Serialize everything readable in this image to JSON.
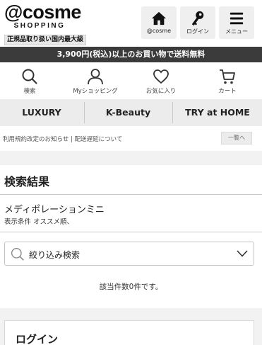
{
  "header": {
    "logo": {
      "main": "@cosme",
      "sub": "SHOPPING",
      "badge": "正規品取り扱い国内最大級"
    },
    "buttons": [
      {
        "label": "@cosme",
        "icon": "home-icon"
      },
      {
        "label": "ログイン",
        "icon": "key-icon"
      },
      {
        "label": "メニュー",
        "icon": "hamburger-icon"
      }
    ]
  },
  "banner": {
    "text": "3,900円(税込)以上のお買い物で送料無料"
  },
  "nav": [
    {
      "label": "検索",
      "icon": "search-icon"
    },
    {
      "label": "Myショッピング",
      "icon": "person-icon"
    },
    {
      "label": "お気に入り",
      "icon": "heart-icon"
    },
    {
      "label": "カート",
      "icon": "cart-icon"
    }
  ],
  "tabs": [
    "LUXURY",
    "K-Beauty",
    "TRY at HOME"
  ],
  "notice": {
    "text": "利用規約改定のお知らせ | 配送遅延について",
    "button": "一覧へ"
  },
  "results": {
    "title": "検索結果",
    "query": "メディポレーションミニ",
    "condition": "表示条件 オススメ順、",
    "filter_label": "絞り込み検索",
    "empty_text": "該当件数0件です。"
  },
  "login": {
    "title": "ログイン"
  },
  "colors": {
    "banner_bg": "#3b3b3b",
    "tab_bg": "#ececec",
    "button_bg": "#efefef"
  }
}
